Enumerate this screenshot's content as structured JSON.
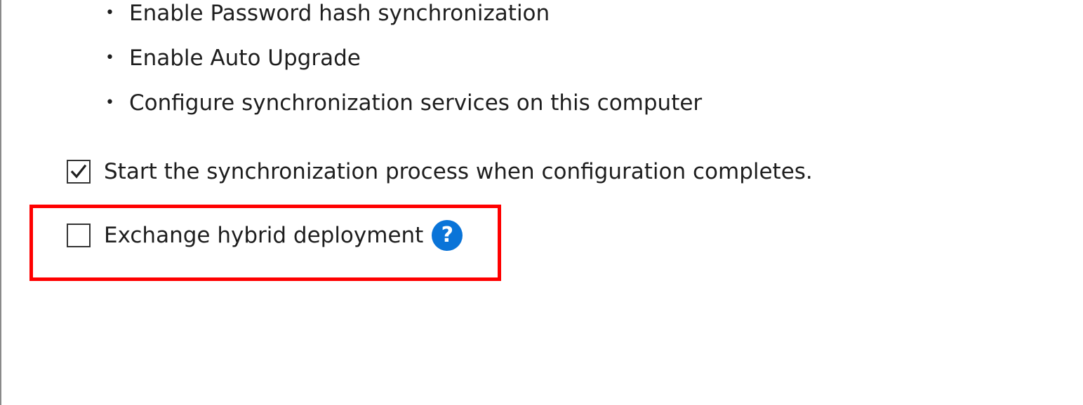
{
  "config_list": {
    "items": [
      {
        "label": "Enable Password hash synchronization"
      },
      {
        "label": "Enable Auto Upgrade"
      },
      {
        "label": "Configure synchronization services on this computer"
      }
    ]
  },
  "options": {
    "start_sync": {
      "label": "Start the synchronization process when configuration completes.",
      "checked": true
    },
    "exchange_hybrid": {
      "label": "Exchange hybrid deployment",
      "checked": false,
      "help_glyph": "?",
      "help_icon": "help-circle-icon"
    }
  },
  "annotation": {
    "highlight_color": "#ff0000"
  },
  "colors": {
    "help_icon_bg": "#0a74d8",
    "text": "#1e1e1e"
  }
}
